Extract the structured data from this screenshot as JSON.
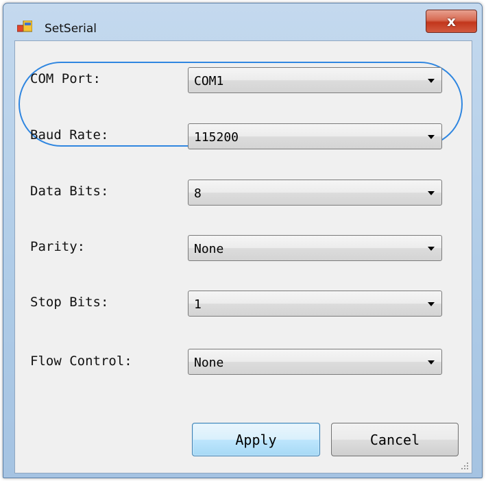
{
  "window": {
    "title": "SetSerial",
    "close_symbol": "x",
    "icon": "windows-forms-app-icon"
  },
  "form": {
    "rows": [
      {
        "label": "COM Port:",
        "value": "COM1"
      },
      {
        "label": "Baud Rate:",
        "value": "115200"
      },
      {
        "label": "Data Bits:",
        "value": "8"
      },
      {
        "label": "Parity:",
        "value": "None"
      },
      {
        "label": "Stop Bits:",
        "value": "1"
      },
      {
        "label": "Flow Control:",
        "value": "None"
      }
    ],
    "apply_label": "Apply",
    "cancel_label": "Cancel"
  },
  "colors": {
    "highlight": "#2f86e0",
    "close_button": "#c2361c",
    "apply_border": "#3c7fb1"
  }
}
